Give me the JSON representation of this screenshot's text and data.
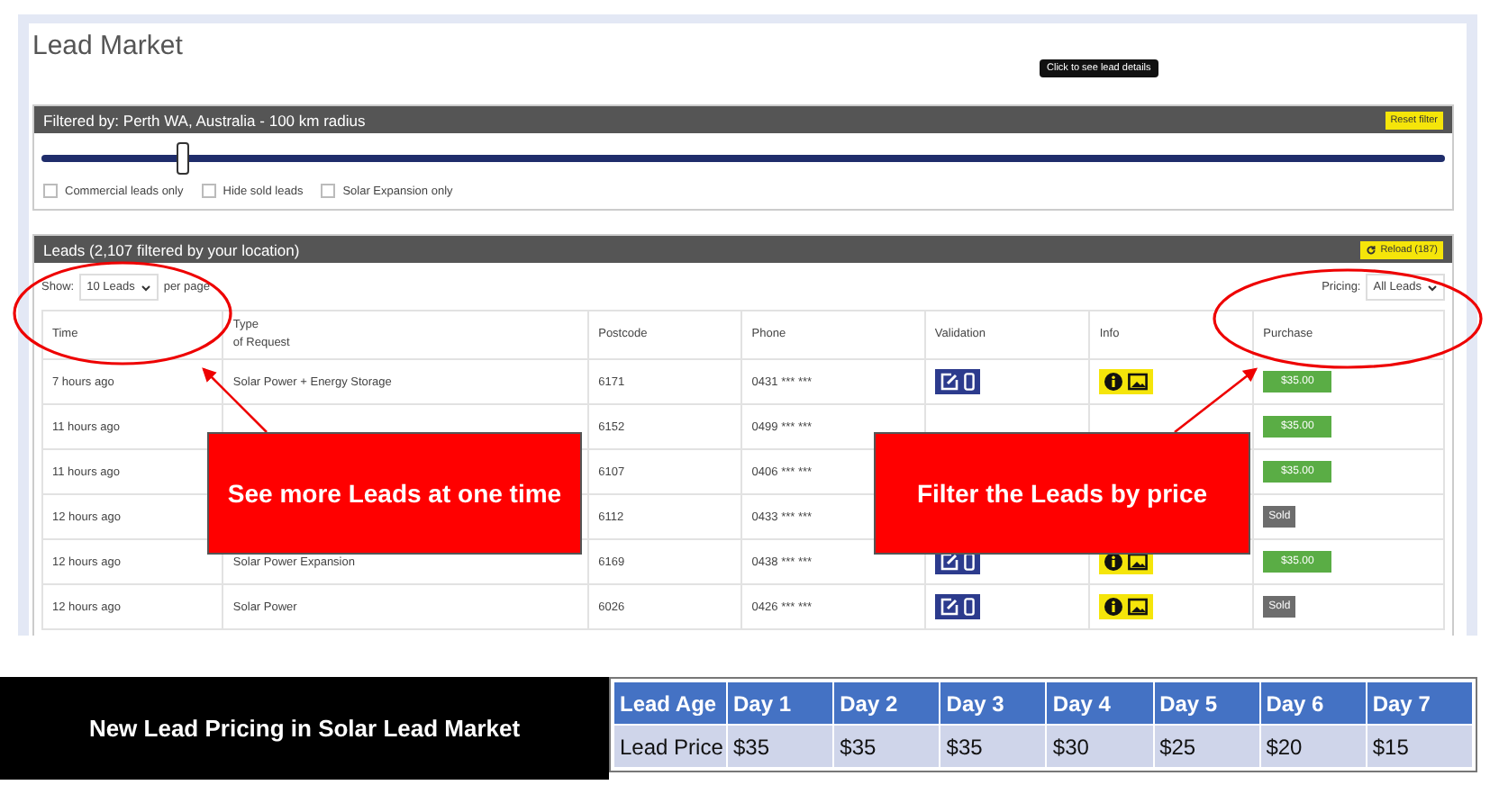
{
  "page": {
    "title": "Lead Market",
    "tooltip": "Click to see lead details"
  },
  "filter": {
    "title": "Filtered by: Perth WA, Australia - 100 km radius",
    "reset_button": "Reset filter",
    "radius_slider": {
      "level": 0.1
    },
    "options": [
      {
        "label": "Commercial leads only",
        "checked": false
      },
      {
        "label": "Hide sold leads",
        "checked": false
      },
      {
        "label": "Solar Expansion only",
        "checked": false
      }
    ]
  },
  "leads": {
    "title": "Leads (2,107 filtered by your location)",
    "reload_button": "Reload (187)",
    "show_label": "Show:",
    "page_size": "10 Leads",
    "per_page": "per page",
    "pricing_label": "Pricing:",
    "pricing": "All Leads",
    "columns": [
      "Time",
      "Type\nof Request",
      "Postcode",
      "Phone",
      "Validation",
      "Info",
      "Purchase"
    ],
    "rows": [
      {
        "time": "7 hours ago",
        "type": "Solar Power + Energy Storage",
        "postcode": "6171",
        "phone": "0431 *** ***",
        "icons": true,
        "purchase": {
          "kind": "price",
          "label": "$35.00"
        }
      },
      {
        "time": "11 hours ago",
        "postcode": "6152",
        "phone": "0499 *** ***",
        "icons": false,
        "purchase": {
          "kind": "price",
          "label": "$35.00"
        }
      },
      {
        "time": "11 hours ago",
        "postcode": "6107",
        "phone": "0406 *** ***",
        "icons": false,
        "purchase": {
          "kind": "price",
          "label": "$35.00"
        }
      },
      {
        "time": "12 hours ago",
        "postcode": "6112",
        "phone": "0433 *** ***",
        "icons": false,
        "purchase": {
          "kind": "sold",
          "label": "Sold"
        }
      },
      {
        "time": "12 hours ago",
        "type": "Solar Power Expansion",
        "postcode": "6169",
        "phone": "0438 *** ***",
        "icons": true,
        "purchase": {
          "kind": "price",
          "label": "$35.00"
        }
      },
      {
        "time": "12 hours ago",
        "type": "Solar Power",
        "postcode": "6026",
        "phone": "0426 *** ***",
        "icons": true,
        "purchase": {
          "kind": "sold",
          "label": "Sold"
        }
      }
    ]
  },
  "callouts": [
    {
      "text": "See more Leads at one time"
    },
    {
      "text": "Filter the Leads by price"
    }
  ],
  "pricing_banner": {
    "title": "New Lead Pricing in Solar Lead Market",
    "header": [
      "Lead Age",
      "Day 1",
      "Day 2",
      "Day 3",
      "Day 4",
      "Day 5",
      "Day 6",
      "Day 7"
    ],
    "row": [
      "Lead Price",
      "$35",
      "$35",
      "$35",
      "$30",
      "$25",
      "$20",
      "$15"
    ]
  }
}
